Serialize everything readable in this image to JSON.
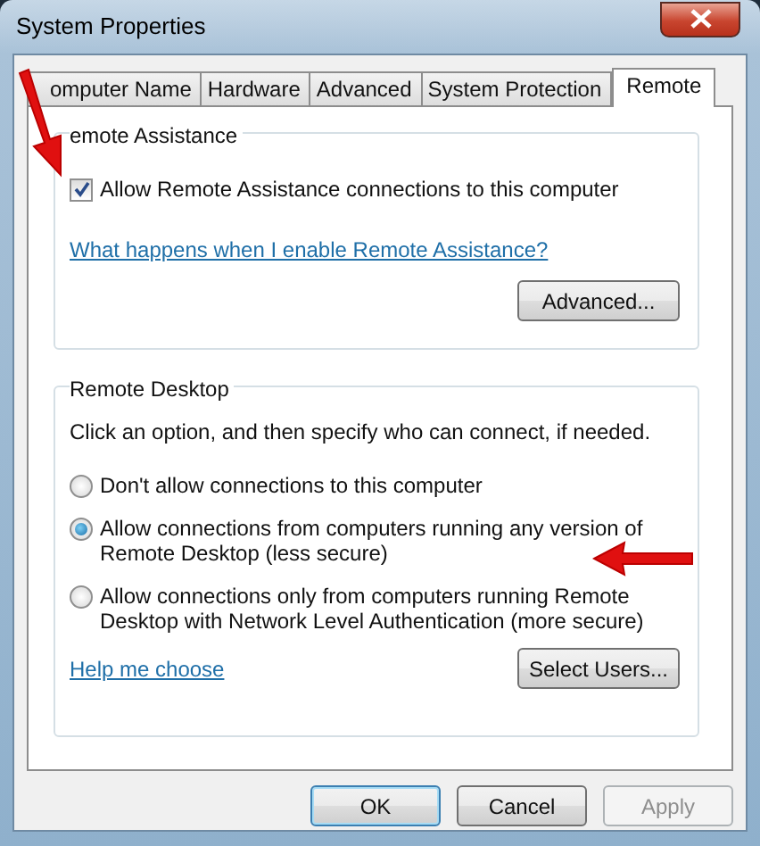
{
  "window": {
    "title": "System Properties"
  },
  "tabs": [
    {
      "label": "omputer Name",
      "selected": false
    },
    {
      "label": "Hardware",
      "selected": false
    },
    {
      "label": "Advanced",
      "selected": false
    },
    {
      "label": "System Protection",
      "selected": false
    },
    {
      "label": "Remote",
      "selected": true
    }
  ],
  "remote_assistance": {
    "legend": "emote Assistance",
    "checkbox": {
      "label": "Allow Remote Assistance connections to this computer",
      "checked": true
    },
    "link": "What happens when I enable Remote Assistance?",
    "button": "Advanced..."
  },
  "remote_desktop": {
    "legend": "Remote Desktop",
    "instruction": "Click an option, and then specify who can connect, if needed.",
    "options": [
      {
        "lines": [
          "Don't allow connections to this computer"
        ],
        "selected": false
      },
      {
        "lines": [
          "Allow connections from computers running any version of",
          "Remote Desktop (less secure)"
        ],
        "selected": true
      },
      {
        "lines": [
          "Allow connections only from computers running Remote",
          "Desktop with Network Level Authentication (more secure)"
        ],
        "selected": false
      }
    ],
    "link": "Help me choose",
    "button": "Select Users..."
  },
  "buttons": [
    {
      "label": "OK",
      "disabled": false,
      "default": true
    },
    {
      "label": "Cancel",
      "disabled": false,
      "default": false
    },
    {
      "label": "Apply",
      "disabled": true,
      "default": false
    }
  ]
}
